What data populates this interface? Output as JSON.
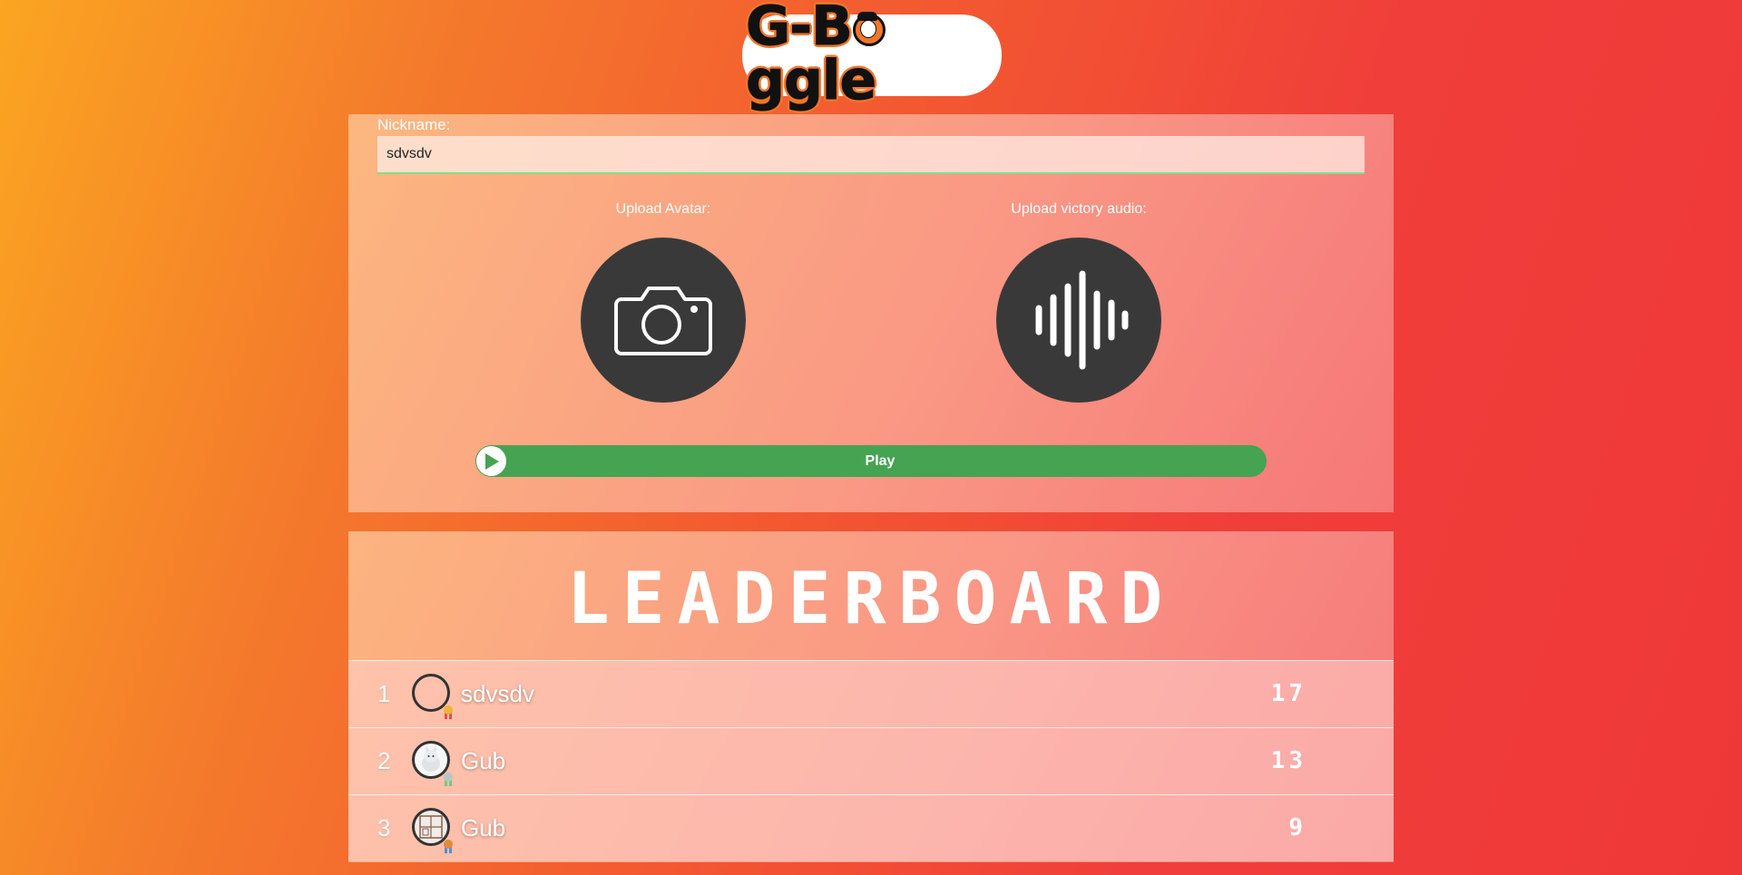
{
  "app": {
    "logo_text_left": "G-B",
    "logo_text_right": "ggle"
  },
  "form": {
    "nickname_label": "Nickname:",
    "nickname_value": "sdvsdv",
    "upload_avatar_label": "Upload Avatar:",
    "upload_audio_label": "Upload victory audio:",
    "play_label": "Play"
  },
  "leaderboard": {
    "title": "LEADERBOARD",
    "rows": [
      {
        "rank": "1",
        "name": "sdvsdv",
        "score": "17",
        "medal_color": "#f0b33a",
        "ribbon_color": "#e84a4a"
      },
      {
        "rank": "2",
        "name": "Gub",
        "score": "13",
        "medal_color": "#b5c9c3",
        "ribbon_color": "#7bc77b"
      },
      {
        "rank": "3",
        "name": "Gub",
        "score": "9",
        "medal_color": "#e08a3a",
        "ribbon_color": "#4a8fe8"
      }
    ]
  },
  "colors": {
    "play_green": "#45a351",
    "upload_circle": "#3a3939"
  }
}
